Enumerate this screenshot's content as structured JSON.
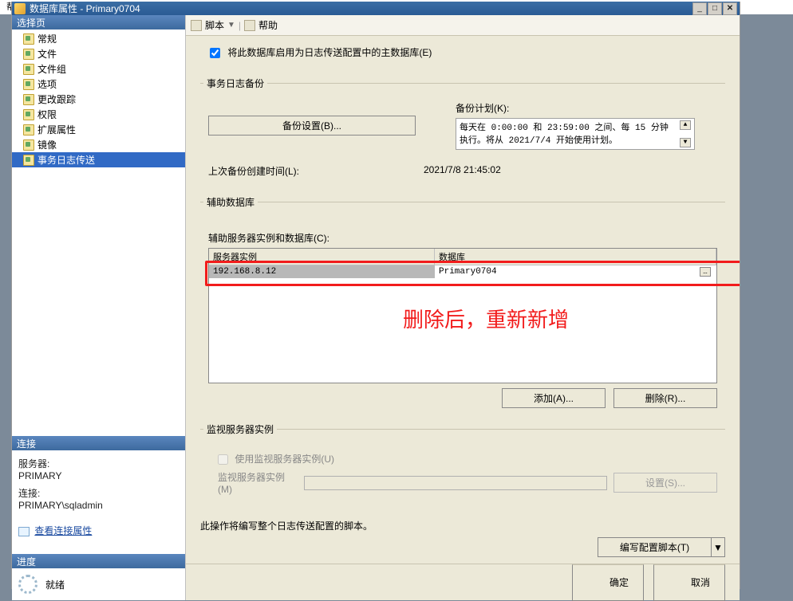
{
  "top_menu": "帮助(H)",
  "window": {
    "title": "数据库属性 - Primary0704"
  },
  "left": {
    "select_page": "选择页",
    "nav": [
      "常规",
      "文件",
      "文件组",
      "选项",
      "更改跟踪",
      "权限",
      "扩展属性",
      "镜像",
      "事务日志传送"
    ],
    "conn_hdr": "连接",
    "server_lbl": "服务器:",
    "server_val": "PRIMARY",
    "conn_lbl": "连接:",
    "conn_val": "PRIMARY\\sqladmin",
    "view_link": "查看连接属性",
    "progress_hdr": "进度",
    "ready": "就绪"
  },
  "toolbar": {
    "script": "脚本",
    "help": "帮助"
  },
  "main": {
    "enable_chk": "将此数据库启用为日志传送配置中的主数据库(E)",
    "backup_grp": "事务日志备份",
    "backup_settings_btn": "备份设置(B)...",
    "schedule_lbl": "备份计划(K):",
    "schedule_text": "每天在 0:00:00 和 23:59:00 之间、每 15 分钟 执行。将从 2021/7/4 开始使用计划。",
    "last_backup_lbl": "上次备份创建时间(L):",
    "last_backup_val": "2021/7/8 21:45:02",
    "secondary_grp": "辅助数据库",
    "secondary_lbl": "辅助服务器实例和数据库(C):",
    "th_server": "服务器实例",
    "th_db": "数据库",
    "row_server": "192.168.8.12",
    "row_db": "Primary0704",
    "add_btn": "添加(A)...",
    "remove_btn": "删除(R)...",
    "monitor_grp": "监视服务器实例",
    "monitor_use_chk": "使用监视服务器实例(U)",
    "monitor_lbl": "监视服务器实例(M)",
    "settings_btn": "设置(S)...",
    "note": "此操作将编写整个日志传送配置的脚本。",
    "config_btn": "编写配置脚本(T)"
  },
  "annotation": "删除后，重新新增",
  "footer": {
    "ok": "确定",
    "cancel": "取消"
  }
}
